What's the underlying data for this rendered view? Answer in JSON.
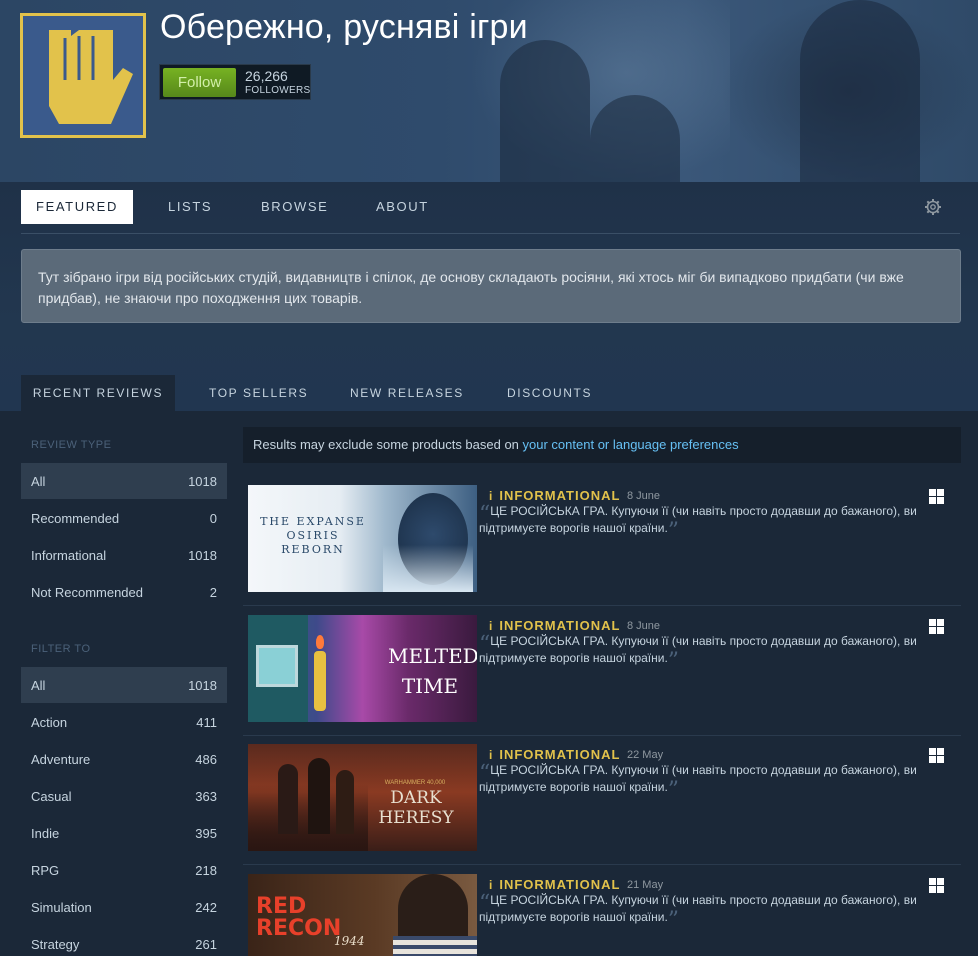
{
  "curator": {
    "name": "Обережно, руснявi iгри",
    "follow_label": "Follow",
    "followers_count": "26,266",
    "followers_label": "FOLLOWERS"
  },
  "nav": {
    "tabs": [
      "FEATURED",
      "LISTS",
      "BROWSE",
      "ABOUT"
    ],
    "active": "FEATURED",
    "settings_icon": "gear-icon"
  },
  "description": "Тут зібрано ігри від російських студій, видавництв і спілок, де основу складають росіяни, які хтось міг би випадково придбати (чи вже придбав), не знаючи про походження цих товарів.",
  "subtabs": {
    "items": [
      "RECENT REVIEWS",
      "TOP SELLERS",
      "NEW RELEASES",
      "DISCOUNTS"
    ],
    "active": "RECENT REVIEWS"
  },
  "sidebar": {
    "review_type_heading": "REVIEW TYPE",
    "review_types": [
      {
        "label": "All",
        "count": "1018"
      },
      {
        "label": "Recommended",
        "count": "0"
      },
      {
        "label": "Informational",
        "count": "1018"
      },
      {
        "label": "Not Recommended",
        "count": "2"
      }
    ],
    "filter_heading": "FILTER TO",
    "filters": [
      {
        "label": "All",
        "count": "1018"
      },
      {
        "label": "Action",
        "count": "411"
      },
      {
        "label": "Adventure",
        "count": "486"
      },
      {
        "label": "Casual",
        "count": "363"
      },
      {
        "label": "Indie",
        "count": "395"
      },
      {
        "label": "RPG",
        "count": "218"
      },
      {
        "label": "Simulation",
        "count": "242"
      },
      {
        "label": "Strategy",
        "count": "261"
      }
    ]
  },
  "notice": {
    "text": "Results may exclude some products based on ",
    "link": "your content or language preferences"
  },
  "reviews": [
    {
      "game": "THE EXPANSE OSIRIS REBORN",
      "tag": "INFORMATIONAL",
      "date": "8 June",
      "text": "ЦЕ РОСІЙСЬКА ГРА. Купуючи її (чи навіть просто додавши до бажаного), ви підтримуєте ворогів нашої країни.",
      "platform_icon": "windows-icon"
    },
    {
      "game": "MELTED TIME",
      "tag": "INFORMATIONAL",
      "date": "8 June",
      "text": "ЦЕ РОСІЙСЬКА ГРА. Купуючи її (чи навіть просто додавши до бажаного), ви підтримуєте ворогів нашої країни.",
      "platform_icon": "windows-icon"
    },
    {
      "game": "DARK HERESY",
      "game_franchise": "WARHAMMER 40,000",
      "tag": "INFORMATIONAL",
      "date": "22 May",
      "text": "ЦЕ РОСІЙСЬКА ГРА. Купуючи її (чи навіть просто додавши до бажаного), ви підтримуєте ворогів нашої країни.",
      "platform_icon": "windows-icon"
    },
    {
      "game": "RED RECON",
      "game_year": "1944",
      "tag": "INFORMATIONAL",
      "date": "21 May",
      "text": "ЦЕ РОСІЙСЬКА ГРА. Купуючи її (чи навіть просто додавши до бажаного), ви підтримуєте ворогів нашої країни.",
      "platform_icon": "windows-icon"
    }
  ],
  "colors": {
    "accent_yellow": "#e2c24b",
    "follow_green": "#75b022",
    "link_blue": "#66c0f4",
    "page_bg": "#1b2838"
  }
}
